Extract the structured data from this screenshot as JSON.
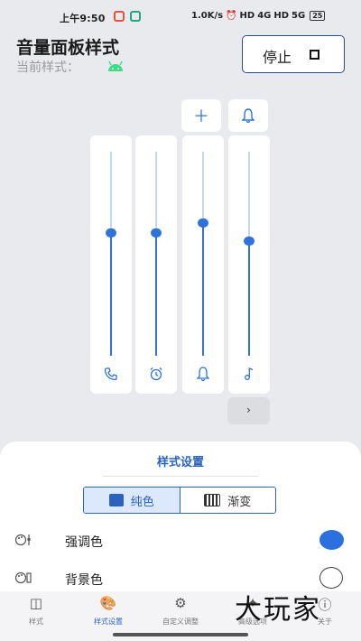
{
  "status_bar": {
    "time": "上午9:50",
    "net_speed": "1.0K/s",
    "alarm_icon": "⏰",
    "hd_label_1": "HD",
    "sig_1": "4G",
    "hd_label_2": "HD",
    "sig_2": "5G",
    "battery": "25"
  },
  "header": {
    "title": "音量面板样式",
    "current_style_label": "当前样式：",
    "stop_label": "停止"
  },
  "volume_panel": {
    "accent_color": "#2f73d9",
    "add_icon": "＋",
    "bell_icon": "🔔",
    "sliders": [
      {
        "name": "call",
        "icon": "📞",
        "level": 0.6
      },
      {
        "name": "alarm",
        "icon": "⏰",
        "level": 0.6
      },
      {
        "name": "notification",
        "icon": "🔔",
        "level": 0.65
      },
      {
        "name": "media",
        "icon": "♪",
        "level": 0.56
      }
    ],
    "expand_label": "›"
  },
  "style_settings": {
    "title": "样式设置",
    "tabs": [
      {
        "label": "纯色",
        "active": true
      },
      {
        "label": "渐变",
        "active": false
      }
    ],
    "rows": [
      {
        "label": "强调色",
        "icon": "🎨",
        "color": "#2b6fe0"
      },
      {
        "label": "背景色",
        "icon": "🎨",
        "color": "#ffffff"
      }
    ]
  },
  "bottom_nav": {
    "items": [
      {
        "label": "样式",
        "icon": "◫",
        "active": false
      },
      {
        "label": "样式设置",
        "icon": "🎨",
        "active": true
      },
      {
        "label": "自定义调整",
        "icon": "⚙",
        "active": false
      },
      {
        "label": "高级选项",
        "icon": "✦",
        "active": false
      },
      {
        "label": "关于",
        "icon": "ⓘ",
        "active": false
      }
    ]
  },
  "watermark": "大玩家"
}
